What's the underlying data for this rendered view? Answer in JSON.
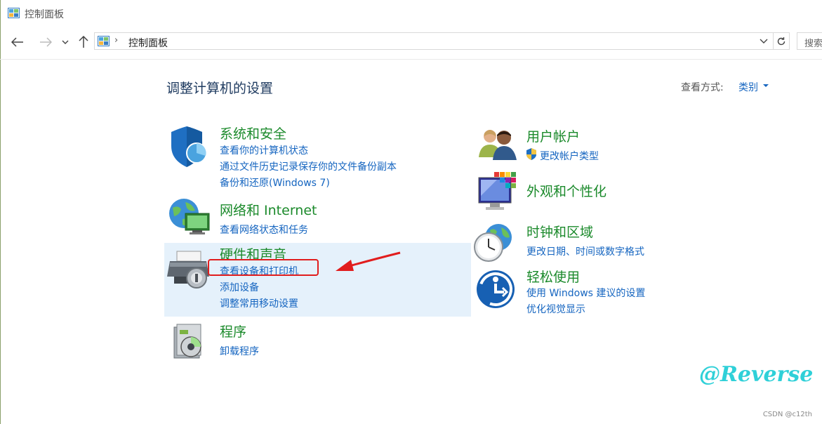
{
  "window": {
    "title": "控制面板"
  },
  "address_bar": {
    "path": "控制面板",
    "search_placeholder": "搜索"
  },
  "page": {
    "heading": "调整计算机的设置",
    "view_by_label": "查看方式:",
    "view_by_value": "类别"
  },
  "categories_left": [
    {
      "title": "系统和安全",
      "links": [
        "查看你的计算机状态",
        "通过文件历史记录保存你的文件备份副本",
        "备份和还原(Windows 7)"
      ]
    },
    {
      "title": "网络和 Internet",
      "links": [
        "查看网络状态和任务"
      ]
    },
    {
      "title": "硬件和声音",
      "links": [
        "查看设备和打印机",
        "添加设备",
        "调整常用移动设置"
      ]
    },
    {
      "title": "程序",
      "links": [
        "卸载程序"
      ]
    }
  ],
  "categories_right": [
    {
      "title": "用户帐户",
      "links": [
        "更改帐户类型"
      ]
    },
    {
      "title": "外观和个性化",
      "links": []
    },
    {
      "title": "时钟和区域",
      "links": [
        "更改日期、时间或数字格式"
      ]
    },
    {
      "title": "轻松使用",
      "links": [
        "使用 Windows 建议的设置",
        "优化视觉显示"
      ]
    }
  ],
  "watermark": "@Reverse",
  "credit": "CSDN @c12th",
  "colors": {
    "category_title": "#1b8a2b",
    "link": "#1565c0",
    "highlight": "#e5f1fb",
    "annotation": "#e11d1d"
  }
}
